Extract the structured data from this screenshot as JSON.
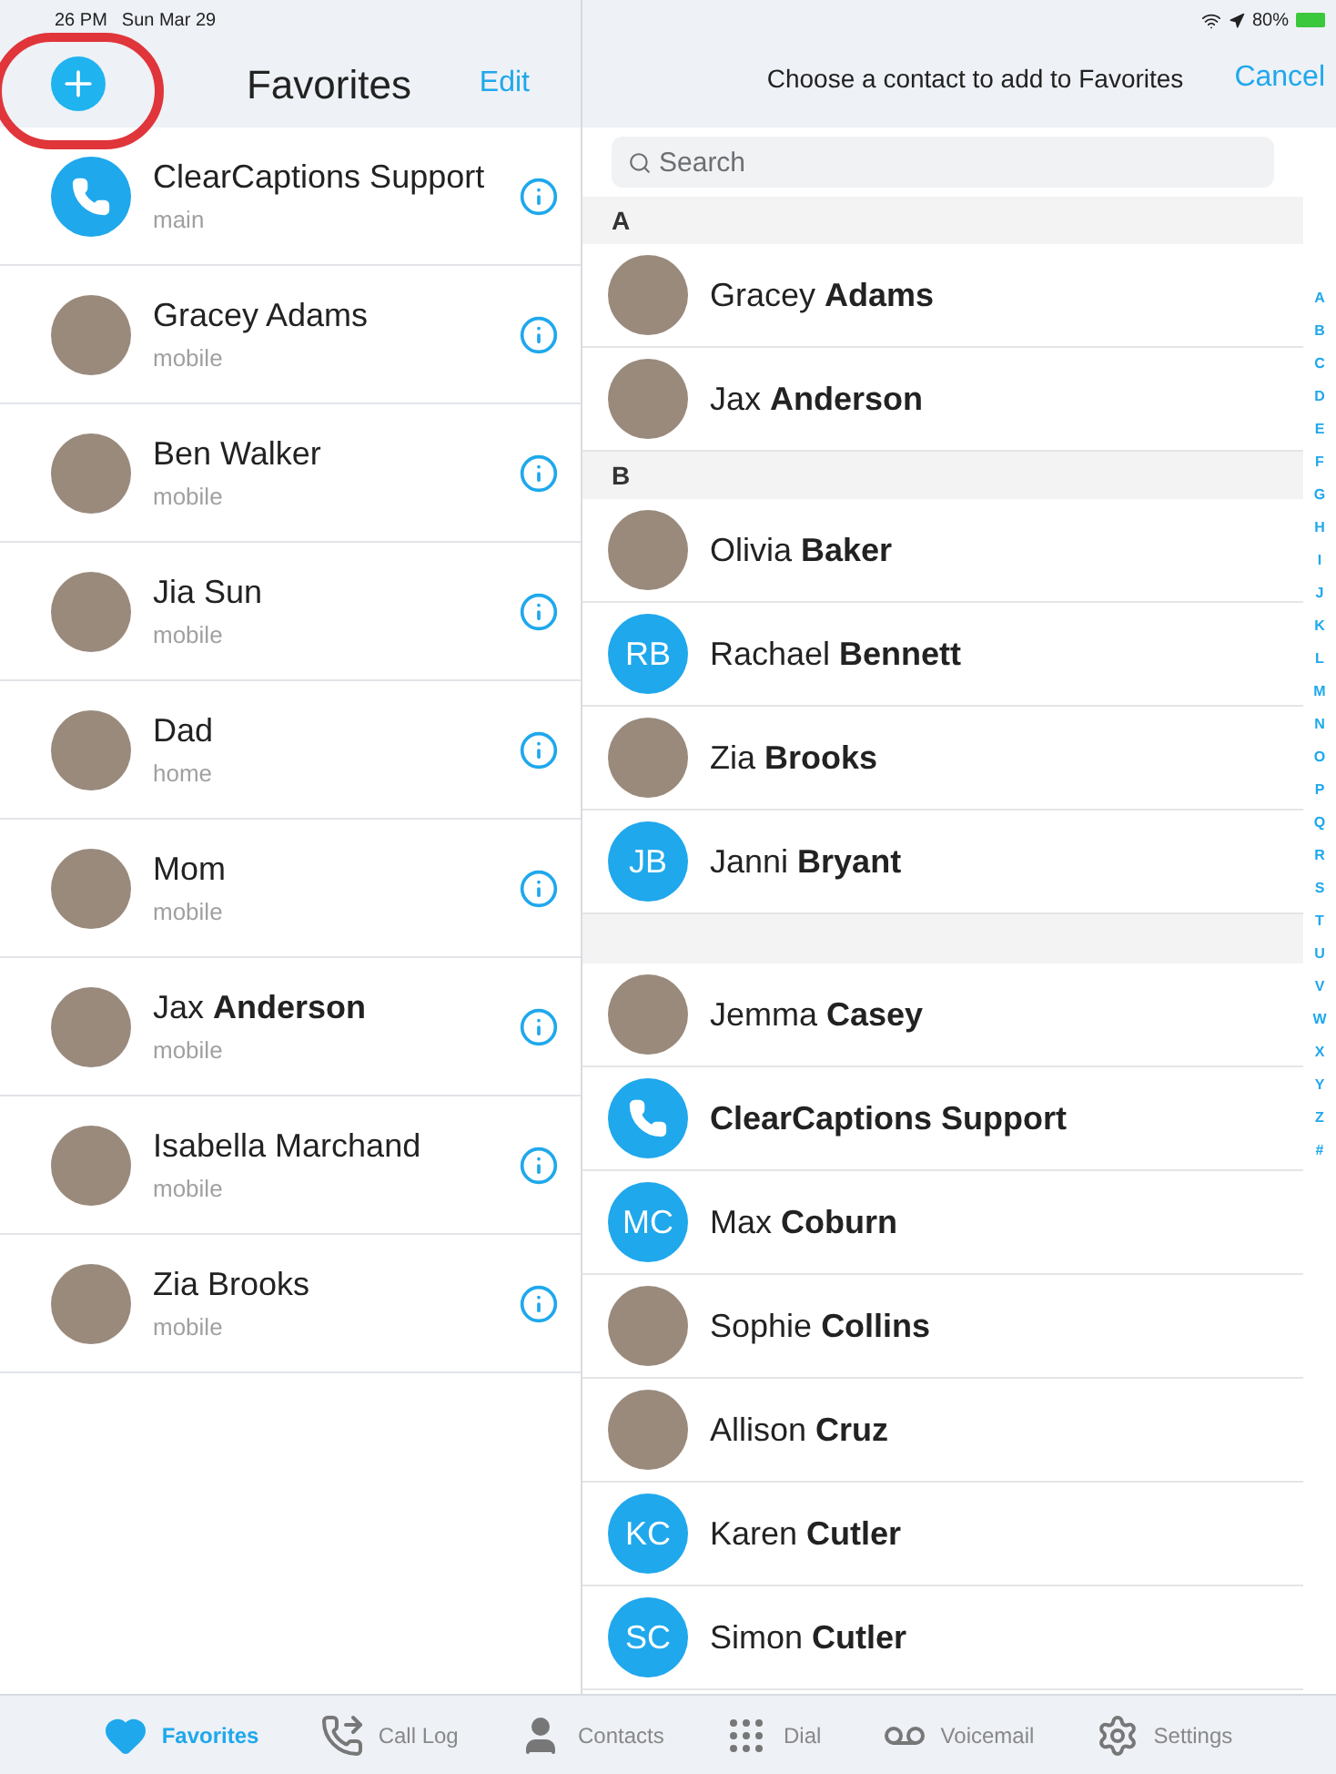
{
  "status_bar": {
    "time": "26 PM",
    "date": "Sun Mar 29",
    "battery": "80%"
  },
  "favorites": {
    "title": "Favorites",
    "edit": "Edit",
    "items": [
      {
        "name": "ClearCaptions Support",
        "detail": "main",
        "avatar": {
          "kind": "logo"
        }
      },
      {
        "name": "Gracey Adams",
        "detail": "mobile",
        "avatar": {
          "kind": "photo"
        }
      },
      {
        "name": "Ben Walker",
        "detail": "mobile",
        "avatar": {
          "kind": "photo"
        }
      },
      {
        "name": "Jia Sun",
        "detail": "mobile",
        "avatar": {
          "kind": "photo"
        }
      },
      {
        "name": "Dad",
        "detail": "home",
        "avatar": {
          "kind": "photo"
        }
      },
      {
        "name": "Mom",
        "detail": "mobile",
        "avatar": {
          "kind": "photo"
        }
      },
      {
        "name": "Jax **Anderson**",
        "detail": "mobile",
        "avatar": {
          "kind": "photo"
        }
      },
      {
        "name": "Isabella Marchand",
        "detail": "mobile",
        "avatar": {
          "kind": "photo"
        }
      },
      {
        "name": "Zia Brooks",
        "detail": "mobile",
        "avatar": {
          "kind": "photo"
        }
      }
    ]
  },
  "picker": {
    "prompt": "Choose a contact to add to Favorites",
    "cancel": "Cancel",
    "search": {
      "placeholder": "Search"
    },
    "sections": [
      {
        "title": "A",
        "contacts": [
          {
            "first": "Gracey",
            "last": "Adams",
            "avatar": {
              "kind": "photo"
            }
          },
          {
            "first": "Jax",
            "last": "Anderson",
            "avatar": {
              "kind": "photo"
            }
          }
        ]
      },
      {
        "title": "B",
        "contacts": [
          {
            "first": "Olivia",
            "last": "Baker",
            "avatar": {
              "kind": "photo"
            }
          },
          {
            "first": "Rachael",
            "last": "Bennett",
            "avatar": {
              "kind": "initials",
              "initials": "RB"
            }
          },
          {
            "first": "Zia",
            "last": "Brooks",
            "avatar": {
              "kind": "photo"
            }
          },
          {
            "first": "Janni",
            "last": "Bryant",
            "avatar": {
              "kind": "initials",
              "initials": "JB"
            }
          }
        ]
      },
      {
        "contacts": [
          {
            "first": "Jemma",
            "last": "Casey",
            "avatar": {
              "kind": "photo"
            }
          },
          {
            "last": "ClearCaptions Support",
            "avatar": {
              "kind": "logo"
            }
          },
          {
            "first": "Max",
            "last": "Coburn",
            "avatar": {
              "kind": "initials",
              "initials": "MC"
            }
          },
          {
            "first": "Sophie",
            "last": "Collins",
            "avatar": {
              "kind": "photo"
            }
          },
          {
            "first": "Allison",
            "last": "Cruz",
            "avatar": {
              "kind": "photo"
            }
          },
          {
            "first": "Karen",
            "last": "Cutler",
            "avatar": {
              "kind": "initials",
              "initials": "KC"
            }
          },
          {
            "first": "Simon",
            "last": "Cutler",
            "avatar": {
              "kind": "initials",
              "initials": "SC"
            }
          }
        ]
      }
    ],
    "index": [
      "A",
      "B",
      "C",
      "D",
      "E",
      "F",
      "G",
      "H",
      "I",
      "J",
      "K",
      "L",
      "M",
      "N",
      "O",
      "P",
      "Q",
      "R",
      "S",
      "T",
      "U",
      "V",
      "W",
      "X",
      "Y",
      "Z",
      "#"
    ]
  },
  "tab_bar": [
    {
      "label": "Favorites",
      "kind": "favorites",
      "selected": true
    },
    {
      "label": "Call Log",
      "kind": "calllog",
      "selected": false
    },
    {
      "label": "Contacts",
      "kind": "contacts",
      "selected": false
    },
    {
      "label": "Dial",
      "kind": "dial",
      "selected": false
    },
    {
      "label": "Voicemail",
      "kind": "voicemail",
      "selected": false
    },
    {
      "label": "Settings",
      "kind": "settings",
      "selected": false
    }
  ]
}
